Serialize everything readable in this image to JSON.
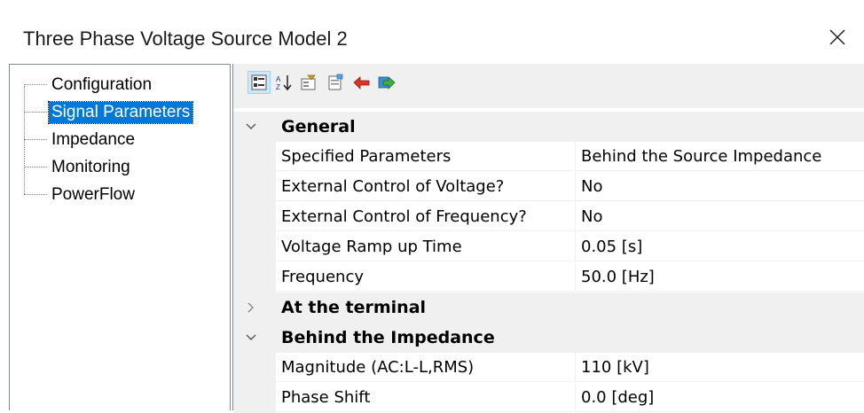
{
  "window": {
    "title": "Three Phase Voltage Source Model 2"
  },
  "tree": {
    "items": [
      {
        "label": "Configuration"
      },
      {
        "label": "Signal Parameters",
        "selected": true
      },
      {
        "label": "Impedance"
      },
      {
        "label": "Monitoring"
      },
      {
        "label": "PowerFlow"
      }
    ]
  },
  "toolbar": {
    "buttons": [
      "categorized-icon",
      "alphabetical-sort-icon",
      "properties-icon",
      "property-pages-icon",
      "import-icon",
      "export-icon"
    ]
  },
  "grid": {
    "categories": [
      {
        "name": "General",
        "expanded": true,
        "properties": [
          {
            "name": "Specified Parameters",
            "value": "Behind the Source Impedance"
          },
          {
            "name": "External Control of Voltage?",
            "value": "No"
          },
          {
            "name": "External Control of Frequency?",
            "value": "No"
          },
          {
            "name": "Voltage Ramp up Time",
            "value": "0.05 [s]"
          },
          {
            "name": "Frequency",
            "value": "50.0 [Hz]"
          }
        ]
      },
      {
        "name": "At the terminal",
        "expanded": false,
        "properties": []
      },
      {
        "name": "Behind the Impedance",
        "expanded": true,
        "properties": [
          {
            "name": "Magnitude (AC:L-L,RMS)",
            "value": "110 [kV]"
          },
          {
            "name": "Phase Shift",
            "value": "0.0 [deg]"
          }
        ]
      }
    ]
  },
  "colors": {
    "selection": "#0078d7",
    "category_bg": "#f0f0f0",
    "border": "#828790"
  }
}
